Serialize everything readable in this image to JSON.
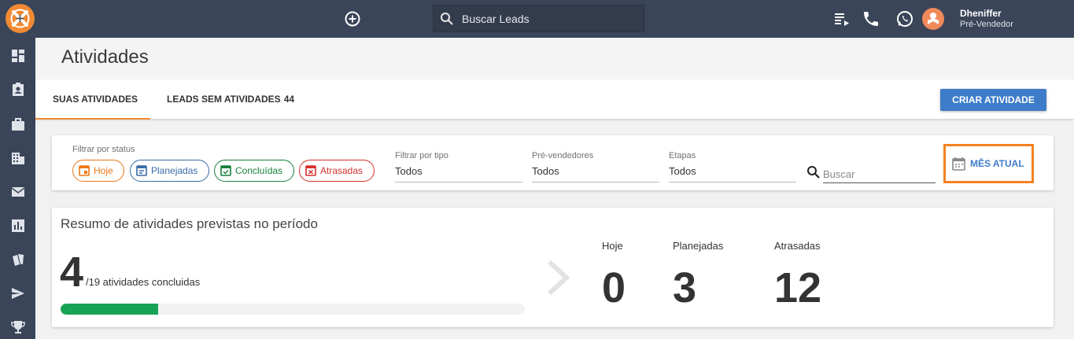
{
  "topbar": {
    "search_placeholder": "Buscar Leads",
    "user_name": "Dheniffer",
    "user_role": "Pré-Vendedor"
  },
  "header": {
    "title": "Atividades"
  },
  "tabs": [
    {
      "label": "SUAS ATIVIDADES",
      "active": true
    },
    {
      "label": "LEADS SEM ATIVIDADES",
      "count": "44",
      "active": false
    }
  ],
  "create_button": "CRIAR ATIVIDADE",
  "filters": {
    "status_label": "Filtrar por status",
    "chips": [
      {
        "label": "Hoje",
        "color": "#ea7817"
      },
      {
        "label": "Planejadas",
        "color": "#3a6aa6"
      },
      {
        "label": "Concluídas",
        "color": "#16803c"
      },
      {
        "label": "Atrasadas",
        "color": "#d5302d"
      }
    ],
    "type": {
      "label": "Filtrar por tipo",
      "value": "Todos"
    },
    "presellers": {
      "label": "Pré-vendedores",
      "value": "Todos"
    },
    "stages": {
      "label": "Etapas",
      "value": "Todos"
    },
    "search_placeholder": "Buscar",
    "month_button": "MÊS ATUAL"
  },
  "summary": {
    "title": "Resumo de atividades previstas no período",
    "done": "4",
    "of_text": "/19 atividades concluidas",
    "progress_fraction": 0.21,
    "stats": [
      {
        "label": "Hoje",
        "value": "0"
      },
      {
        "label": "Planejadas",
        "value": "3"
      },
      {
        "label": "Atrasadas",
        "value": "12"
      }
    ]
  },
  "colors": {
    "topbar": "#3b4559",
    "accent": "#f08a33",
    "primary": "#3d7cc9",
    "progress": "#16a356"
  }
}
